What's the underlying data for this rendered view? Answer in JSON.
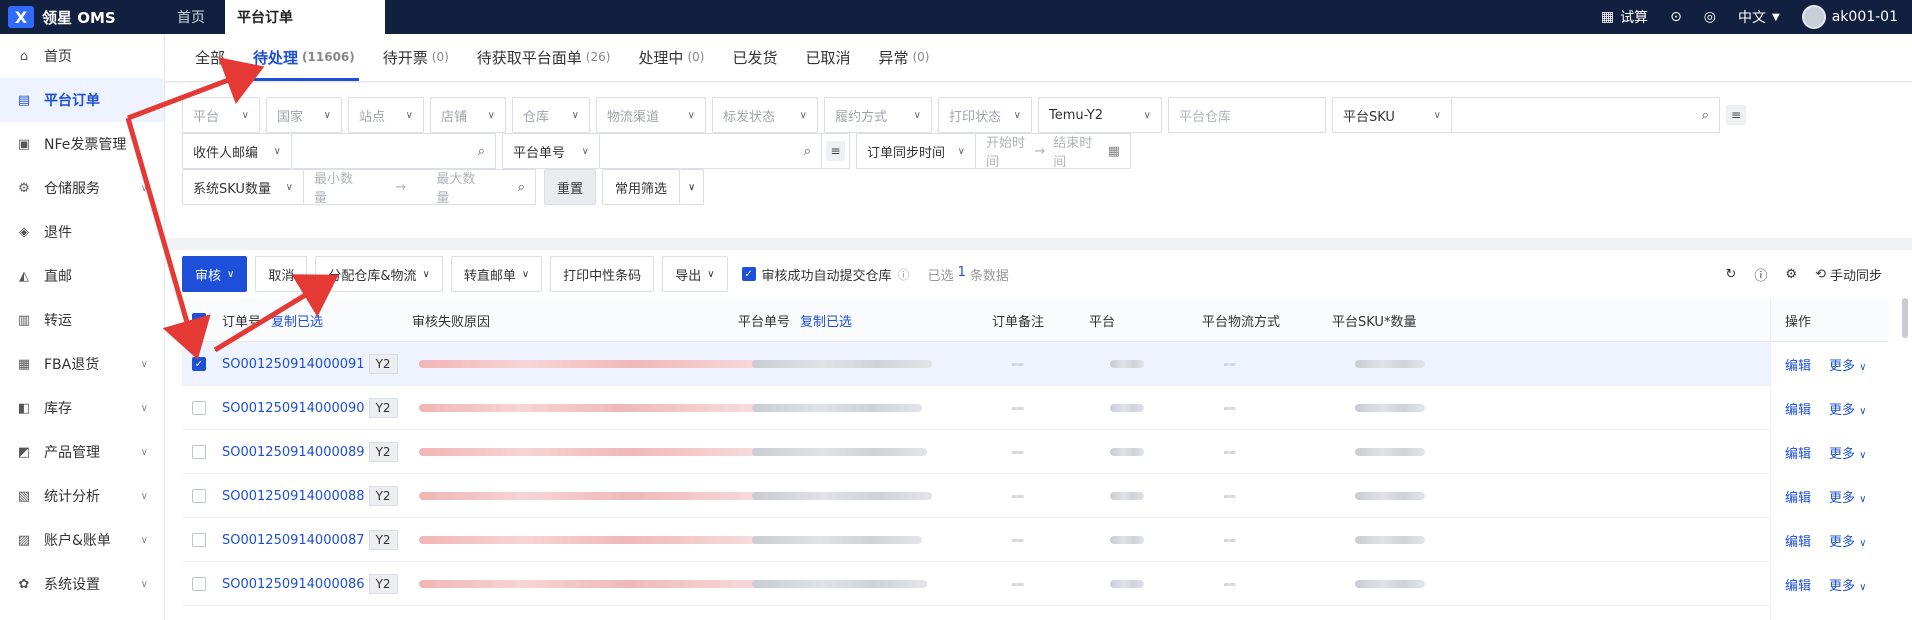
{
  "topbar": {
    "logo": "领星 OMS",
    "tabs": [
      "首页",
      "平台订单"
    ],
    "trial": "试算",
    "lang": "中文",
    "user": "ak001-01"
  },
  "sidebar": {
    "items": [
      {
        "label": "首页",
        "icon": "home-icon"
      },
      {
        "label": "平台订单",
        "icon": "order-icon"
      },
      {
        "label": "NFe发票管理",
        "icon": "invoice-icon"
      },
      {
        "label": "仓储服务",
        "icon": "warehouse-icon"
      },
      {
        "label": "退件",
        "icon": "return-icon"
      },
      {
        "label": "直邮",
        "icon": "mail-icon"
      },
      {
        "label": "转运",
        "icon": "transfer-icon"
      },
      {
        "label": "FBA退货",
        "icon": "fba-icon"
      },
      {
        "label": "库存",
        "icon": "inventory-icon"
      },
      {
        "label": "产品管理",
        "icon": "product-icon"
      },
      {
        "label": "统计分析",
        "icon": "chart-icon"
      },
      {
        "label": "账户&账单",
        "icon": "account-icon"
      },
      {
        "label": "系统设置",
        "icon": "settings-icon"
      }
    ]
  },
  "status_tabs": [
    {
      "label": "全部",
      "count": ""
    },
    {
      "label": "待处理",
      "count": "(11606)"
    },
    {
      "label": "待开票",
      "count": "(0)"
    },
    {
      "label": "待获取平台面单",
      "count": "(26)"
    },
    {
      "label": "处理中",
      "count": "(0)"
    },
    {
      "label": "已发货",
      "count": ""
    },
    {
      "label": "已取消",
      "count": ""
    },
    {
      "label": "异常",
      "count": "(0)"
    }
  ],
  "filters": {
    "row1": [
      "平台",
      "国家",
      "站点",
      "店铺",
      "仓库",
      "物流渠道",
      "标发状态",
      "履约方式",
      "打印状态"
    ],
    "platform_value": "Temu-Y2",
    "platform_warehouse": "平台仓库",
    "platform_sku": "平台SKU",
    "recipient_email": "收件人邮编",
    "platform_order_no": "平台单号",
    "sync_time": "订单同步时间",
    "start_time": "开始时间",
    "end_time": "结束时间",
    "sku_qty": "系统SKU数量",
    "min_qty": "最小数量",
    "max_qty": "最大数量",
    "reset": "重置",
    "common_filter": "常用筛选"
  },
  "toolbar": {
    "audit": "审核",
    "cancel": "取消",
    "assign": "分配仓库&物流",
    "to_direct": "转直邮单",
    "print_barcode": "打印中性条码",
    "export": "导出",
    "auto_submit": "审核成功自动提交仓库",
    "selected_prefix": "已选",
    "selected_count": "1",
    "selected_suffix": "条数据",
    "manual_sync": "手动同步"
  },
  "table": {
    "headers": {
      "order_no": "订单号",
      "copy_selected": "复制已选",
      "fail_reason": "审核失败原因",
      "platform_no": "平台单号",
      "copy_selected2": "复制已选",
      "remark": "订单备注",
      "platform": "平台",
      "logistics": "平台物流方式",
      "sku_qty": "平台SKU*数量",
      "ops": "操作"
    },
    "rows": [
      {
        "order": "SO001250914000091",
        "tag": "Y2",
        "checked": true
      },
      {
        "order": "SO001250914000090",
        "tag": "Y2",
        "checked": false
      },
      {
        "order": "SO001250914000089",
        "tag": "Y2",
        "checked": false
      },
      {
        "order": "SO001250914000088",
        "tag": "Y2",
        "checked": false
      },
      {
        "order": "SO001250914000087",
        "tag": "Y2",
        "checked": false
      },
      {
        "order": "SO001250914000086",
        "tag": "Y2",
        "checked": false
      },
      {
        "order": "",
        "tag": "",
        "checked": false
      }
    ],
    "edit": "编辑",
    "more": "更多"
  },
  "colors": {
    "accent": "#1d4fd8",
    "topbar": "#12203f",
    "arrow": "#e53935"
  }
}
